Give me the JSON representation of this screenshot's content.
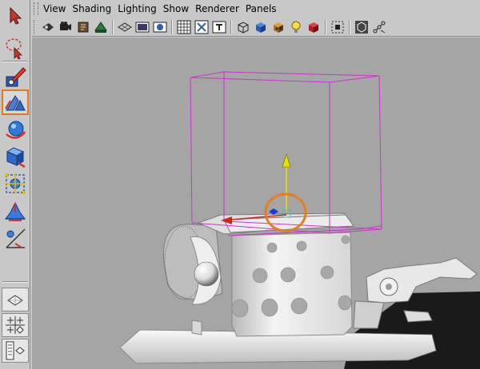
{
  "menu": {
    "items": [
      "View",
      "Shading",
      "Lighting",
      "Show",
      "Renderer",
      "Panels"
    ]
  },
  "iconbar": {
    "icons": [
      "select-camera-icon",
      "camera-attributes-icon",
      "bookmark-icon",
      "image-plane-icon",
      "grid-icon",
      "film-gate-icon",
      "resolution-gate-icon",
      "gate-mask-icon",
      "field-chart-icon",
      "safe-action-icon",
      "safe-title-icon",
      "wireframe-icon",
      "smooth-shade-icon",
      "textured-icon",
      "use-all-lights-icon",
      "shadows-icon",
      "isolate-select-icon",
      "xray-icon",
      "xray-joints-icon"
    ]
  },
  "toolbox": {
    "tools": [
      "select-tool-icon",
      "lasso-tool-icon",
      "paint-select-tool-icon",
      "move-tool-icon",
      "rotate-tool-icon",
      "scale-tool-icon",
      "universal-manipulator-icon",
      "soft-modification-icon",
      "show-manipulator-icon"
    ],
    "active_tool": "move-tool-icon",
    "layouts": [
      "single-perspective-layout-icon",
      "four-view-layout-icon",
      "persp-outliner-layout-icon"
    ]
  },
  "colors": {
    "viewport_bg": "#a5a5a5",
    "selection_box": "#cc33cc",
    "highlight_ring": "#e08020",
    "toolbar_bg": "#c8c8c8"
  }
}
